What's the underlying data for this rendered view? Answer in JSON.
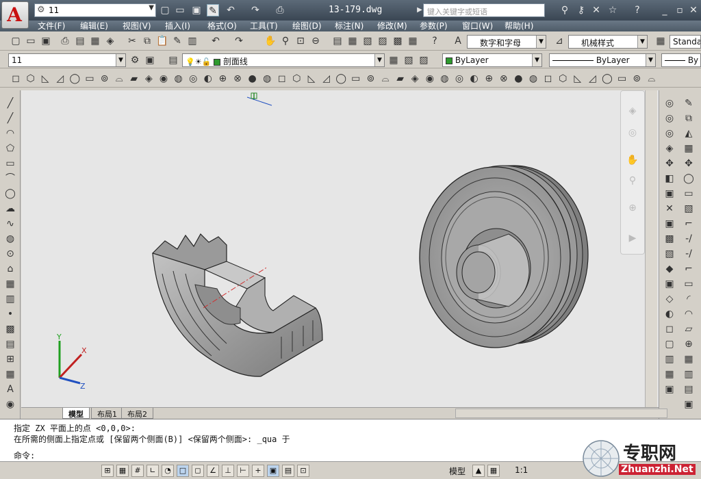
{
  "title_bar": {
    "workspace": "11",
    "filename": "13-179.dwg",
    "search_placeholder": "键入关键字或短语"
  },
  "menu": [
    "文件(F)",
    "编辑(E)",
    "视图(V)",
    "插入(I)",
    "格式(O)",
    "工具(T)",
    "绘图(D)",
    "标注(N)",
    "修改(M)",
    "参数(P)",
    "窗口(W)",
    "帮助(H)"
  ],
  "styles": {
    "text_style": "数字和字母",
    "dim_style": "机械样式",
    "table_style": "Standa"
  },
  "layers": {
    "workspace_combo": "11",
    "layer_name": "剖面线",
    "color": "ByLayer",
    "linetype": "ByLayer",
    "lineweight": "By"
  },
  "tabs": [
    "模型",
    "布局1",
    "布局2"
  ],
  "command_lines": [
    "指定 ZX 平面上的点 <0,0,0>:",
    "在所需的侧面上指定点或 [保留两个侧面(B)] <保留两个侧面>: _qua 于",
    "命令:"
  ],
  "status": {
    "model_label": "模型",
    "scale": "1:1"
  },
  "watermark": {
    "brand": "专职网",
    "url": "Zhuanzhi.Net"
  },
  "colors": {
    "layer_color": "#2e9a2e",
    "axis_x": "#c02020",
    "axis_y": "#20a020",
    "axis_z": "#2050c0"
  }
}
